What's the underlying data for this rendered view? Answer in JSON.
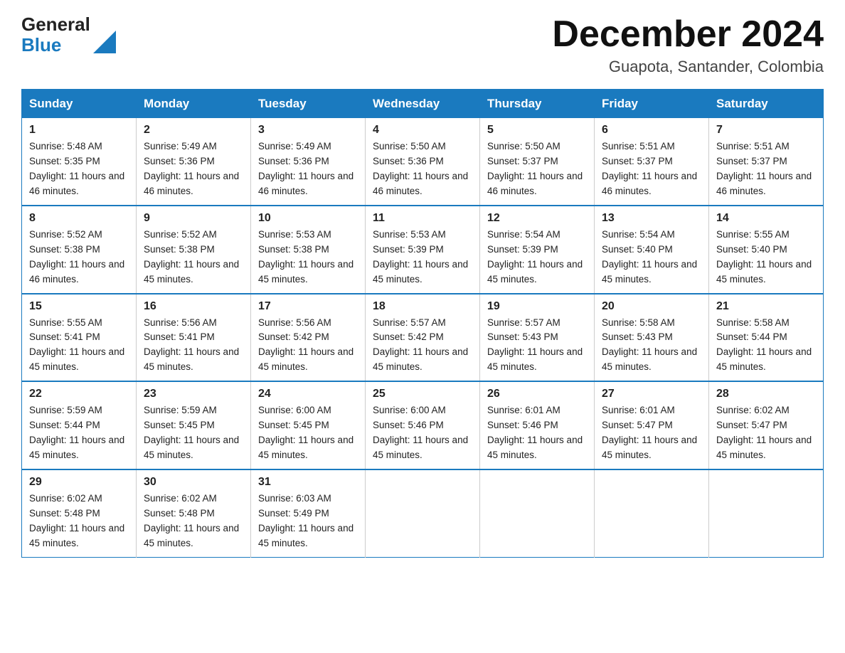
{
  "header": {
    "logo_general": "General",
    "logo_blue": "Blue",
    "month_title": "December 2024",
    "location": "Guapota, Santander, Colombia"
  },
  "weekdays": [
    "Sunday",
    "Monday",
    "Tuesday",
    "Wednesday",
    "Thursday",
    "Friday",
    "Saturday"
  ],
  "weeks": [
    [
      {
        "day": "1",
        "sunrise": "5:48 AM",
        "sunset": "5:35 PM",
        "daylight": "11 hours and 46 minutes."
      },
      {
        "day": "2",
        "sunrise": "5:49 AM",
        "sunset": "5:36 PM",
        "daylight": "11 hours and 46 minutes."
      },
      {
        "day": "3",
        "sunrise": "5:49 AM",
        "sunset": "5:36 PM",
        "daylight": "11 hours and 46 minutes."
      },
      {
        "day": "4",
        "sunrise": "5:50 AM",
        "sunset": "5:36 PM",
        "daylight": "11 hours and 46 minutes."
      },
      {
        "day": "5",
        "sunrise": "5:50 AM",
        "sunset": "5:37 PM",
        "daylight": "11 hours and 46 minutes."
      },
      {
        "day": "6",
        "sunrise": "5:51 AM",
        "sunset": "5:37 PM",
        "daylight": "11 hours and 46 minutes."
      },
      {
        "day": "7",
        "sunrise": "5:51 AM",
        "sunset": "5:37 PM",
        "daylight": "11 hours and 46 minutes."
      }
    ],
    [
      {
        "day": "8",
        "sunrise": "5:52 AM",
        "sunset": "5:38 PM",
        "daylight": "11 hours and 46 minutes."
      },
      {
        "day": "9",
        "sunrise": "5:52 AM",
        "sunset": "5:38 PM",
        "daylight": "11 hours and 45 minutes."
      },
      {
        "day": "10",
        "sunrise": "5:53 AM",
        "sunset": "5:38 PM",
        "daylight": "11 hours and 45 minutes."
      },
      {
        "day": "11",
        "sunrise": "5:53 AM",
        "sunset": "5:39 PM",
        "daylight": "11 hours and 45 minutes."
      },
      {
        "day": "12",
        "sunrise": "5:54 AM",
        "sunset": "5:39 PM",
        "daylight": "11 hours and 45 minutes."
      },
      {
        "day": "13",
        "sunrise": "5:54 AM",
        "sunset": "5:40 PM",
        "daylight": "11 hours and 45 minutes."
      },
      {
        "day": "14",
        "sunrise": "5:55 AM",
        "sunset": "5:40 PM",
        "daylight": "11 hours and 45 minutes."
      }
    ],
    [
      {
        "day": "15",
        "sunrise": "5:55 AM",
        "sunset": "5:41 PM",
        "daylight": "11 hours and 45 minutes."
      },
      {
        "day": "16",
        "sunrise": "5:56 AM",
        "sunset": "5:41 PM",
        "daylight": "11 hours and 45 minutes."
      },
      {
        "day": "17",
        "sunrise": "5:56 AM",
        "sunset": "5:42 PM",
        "daylight": "11 hours and 45 minutes."
      },
      {
        "day": "18",
        "sunrise": "5:57 AM",
        "sunset": "5:42 PM",
        "daylight": "11 hours and 45 minutes."
      },
      {
        "day": "19",
        "sunrise": "5:57 AM",
        "sunset": "5:43 PM",
        "daylight": "11 hours and 45 minutes."
      },
      {
        "day": "20",
        "sunrise": "5:58 AM",
        "sunset": "5:43 PM",
        "daylight": "11 hours and 45 minutes."
      },
      {
        "day": "21",
        "sunrise": "5:58 AM",
        "sunset": "5:44 PM",
        "daylight": "11 hours and 45 minutes."
      }
    ],
    [
      {
        "day": "22",
        "sunrise": "5:59 AM",
        "sunset": "5:44 PM",
        "daylight": "11 hours and 45 minutes."
      },
      {
        "day": "23",
        "sunrise": "5:59 AM",
        "sunset": "5:45 PM",
        "daylight": "11 hours and 45 minutes."
      },
      {
        "day": "24",
        "sunrise": "6:00 AM",
        "sunset": "5:45 PM",
        "daylight": "11 hours and 45 minutes."
      },
      {
        "day": "25",
        "sunrise": "6:00 AM",
        "sunset": "5:46 PM",
        "daylight": "11 hours and 45 minutes."
      },
      {
        "day": "26",
        "sunrise": "6:01 AM",
        "sunset": "5:46 PM",
        "daylight": "11 hours and 45 minutes."
      },
      {
        "day": "27",
        "sunrise": "6:01 AM",
        "sunset": "5:47 PM",
        "daylight": "11 hours and 45 minutes."
      },
      {
        "day": "28",
        "sunrise": "6:02 AM",
        "sunset": "5:47 PM",
        "daylight": "11 hours and 45 minutes."
      }
    ],
    [
      {
        "day": "29",
        "sunrise": "6:02 AM",
        "sunset": "5:48 PM",
        "daylight": "11 hours and 45 minutes."
      },
      {
        "day": "30",
        "sunrise": "6:02 AM",
        "sunset": "5:48 PM",
        "daylight": "11 hours and 45 minutes."
      },
      {
        "day": "31",
        "sunrise": "6:03 AM",
        "sunset": "5:49 PM",
        "daylight": "11 hours and 45 minutes."
      },
      null,
      null,
      null,
      null
    ]
  ]
}
